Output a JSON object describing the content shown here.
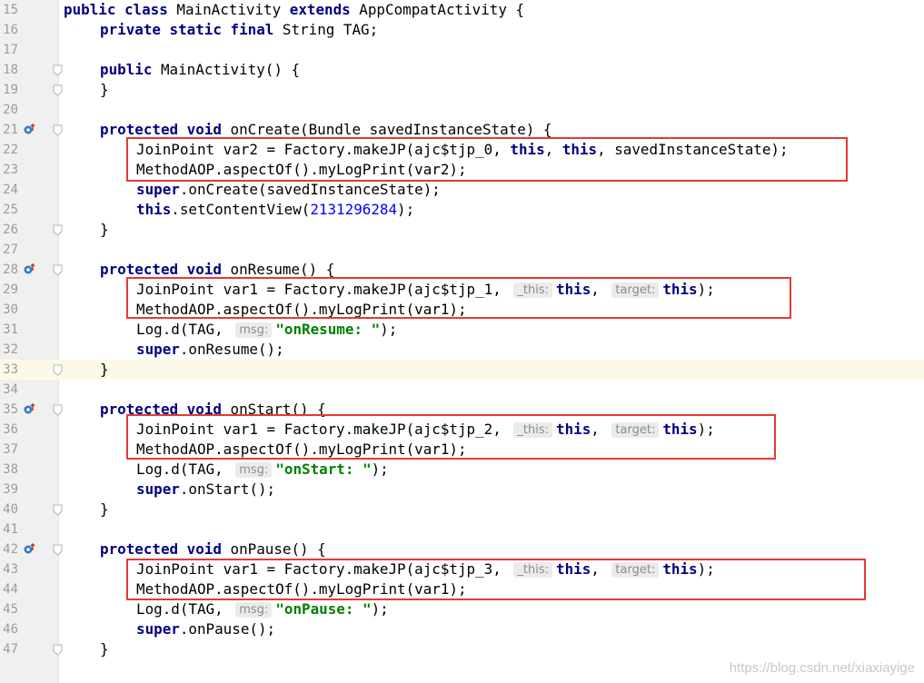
{
  "editor": {
    "lines": [
      {
        "num": "15",
        "parts": [
          {
            "t": "public class ",
            "c": "kw"
          },
          {
            "t": "MainActivity "
          },
          {
            "t": "extends ",
            "c": "kw"
          },
          {
            "t": "AppCompatActivity {"
          }
        ]
      },
      {
        "num": "16",
        "indent": 1,
        "parts": [
          {
            "t": "private static final ",
            "c": "kw"
          },
          {
            "t": "String TAG;"
          }
        ]
      },
      {
        "num": "17",
        "parts": []
      },
      {
        "num": "18",
        "indent": 1,
        "fold": true,
        "parts": [
          {
            "t": "public ",
            "c": "kw"
          },
          {
            "t": "MainActivity() {"
          }
        ]
      },
      {
        "num": "19",
        "indent": 1,
        "fold": true,
        "parts": [
          {
            "t": "}"
          }
        ]
      },
      {
        "num": "20",
        "parts": []
      },
      {
        "num": "21",
        "indent": 1,
        "fold": true,
        "override": true,
        "parts": [
          {
            "t": "protected void ",
            "c": "kw"
          },
          {
            "t": "onCreate(Bundle savedInstanceState) {"
          }
        ]
      },
      {
        "num": "22",
        "indent": 2,
        "parts": [
          {
            "t": "JoinPoint var2 = Factory.makeJP(ajc$tjp_0, "
          },
          {
            "t": "this",
            "c": "kw"
          },
          {
            "t": ", "
          },
          {
            "t": "this",
            "c": "kw"
          },
          {
            "t": ", savedInstanceState);"
          }
        ]
      },
      {
        "num": "23",
        "indent": 2,
        "parts": [
          {
            "t": "MethodAOP.aspectOf().myLogPrint(var2);"
          }
        ]
      },
      {
        "num": "24",
        "indent": 2,
        "parts": [
          {
            "t": "super",
            "c": "kw"
          },
          {
            "t": ".onCreate(savedInstanceState);"
          }
        ]
      },
      {
        "num": "25",
        "indent": 2,
        "parts": [
          {
            "t": "this",
            "c": "kw"
          },
          {
            "t": ".setContentView("
          },
          {
            "t": "2131296284",
            "c": "num"
          },
          {
            "t": ");"
          }
        ]
      },
      {
        "num": "26",
        "indent": 1,
        "fold": true,
        "parts": [
          {
            "t": "}"
          }
        ]
      },
      {
        "num": "27",
        "parts": []
      },
      {
        "num": "28",
        "indent": 1,
        "fold": true,
        "override": true,
        "parts": [
          {
            "t": "protected void ",
            "c": "kw"
          },
          {
            "t": "onResume() {"
          }
        ]
      },
      {
        "num": "29",
        "indent": 2,
        "parts": [
          {
            "t": "JoinPoint var1 = Factory.makeJP(ajc$tjp_1, "
          },
          {
            "t": "_this:",
            "c": "hint"
          },
          {
            "t": "this",
            "c": "kw"
          },
          {
            "t": ", "
          },
          {
            "t": "target:",
            "c": "hint"
          },
          {
            "t": "this",
            "c": "kw"
          },
          {
            "t": ");"
          }
        ]
      },
      {
        "num": "30",
        "indent": 2,
        "parts": [
          {
            "t": "MethodAOP.aspectOf().myLogPrint(var1);"
          }
        ]
      },
      {
        "num": "31",
        "indent": 2,
        "parts": [
          {
            "t": "Log.d(TAG, "
          },
          {
            "t": "msg:",
            "c": "hint"
          },
          {
            "t": "\"onResume: \"",
            "c": "str"
          },
          {
            "t": ");"
          }
        ]
      },
      {
        "num": "32",
        "indent": 2,
        "parts": [
          {
            "t": "super",
            "c": "kw"
          },
          {
            "t": ".onResume();"
          }
        ]
      },
      {
        "num": "33",
        "indent": 1,
        "fold": true,
        "current": true,
        "parts": [
          {
            "t": "}"
          }
        ]
      },
      {
        "num": "34",
        "parts": []
      },
      {
        "num": "35",
        "indent": 1,
        "fold": true,
        "override": true,
        "parts": [
          {
            "t": "protected void ",
            "c": "kw"
          },
          {
            "t": "onStart() {"
          }
        ]
      },
      {
        "num": "36",
        "indent": 2,
        "parts": [
          {
            "t": "JoinPoint var1 = Factory.makeJP(ajc$tjp_2, "
          },
          {
            "t": "_this:",
            "c": "hint"
          },
          {
            "t": "this",
            "c": "kw"
          },
          {
            "t": ", "
          },
          {
            "t": "target:",
            "c": "hint"
          },
          {
            "t": "this",
            "c": "kw"
          },
          {
            "t": ");"
          }
        ]
      },
      {
        "num": "37",
        "indent": 2,
        "parts": [
          {
            "t": "MethodAOP.aspectOf().myLogPrint(var1);"
          }
        ]
      },
      {
        "num": "38",
        "indent": 2,
        "parts": [
          {
            "t": "Log.d(TAG, "
          },
          {
            "t": "msg:",
            "c": "hint"
          },
          {
            "t": "\"onStart: \"",
            "c": "str"
          },
          {
            "t": ");"
          }
        ]
      },
      {
        "num": "39",
        "indent": 2,
        "parts": [
          {
            "t": "super",
            "c": "kw"
          },
          {
            "t": ".onStart();"
          }
        ]
      },
      {
        "num": "40",
        "indent": 1,
        "fold": true,
        "parts": [
          {
            "t": "}"
          }
        ]
      },
      {
        "num": "41",
        "parts": []
      },
      {
        "num": "42",
        "indent": 1,
        "fold": true,
        "override": true,
        "parts": [
          {
            "t": "protected void ",
            "c": "kw"
          },
          {
            "t": "onPause() {"
          }
        ]
      },
      {
        "num": "43",
        "indent": 2,
        "parts": [
          {
            "t": "JoinPoint var1 = Factory.makeJP(ajc$tjp_3, "
          },
          {
            "t": "_this:",
            "c": "hint"
          },
          {
            "t": "this",
            "c": "kw"
          },
          {
            "t": ", "
          },
          {
            "t": "target:",
            "c": "hint"
          },
          {
            "t": "this",
            "c": "kw"
          },
          {
            "t": ");"
          }
        ]
      },
      {
        "num": "44",
        "indent": 2,
        "parts": [
          {
            "t": "MethodAOP.aspectOf().myLogPrint(var1);"
          }
        ]
      },
      {
        "num": "45",
        "indent": 2,
        "parts": [
          {
            "t": "Log.d(TAG, "
          },
          {
            "t": "msg:",
            "c": "hint"
          },
          {
            "t": "\"onPause: \"",
            "c": "str"
          },
          {
            "t": ");"
          }
        ]
      },
      {
        "num": "46",
        "indent": 2,
        "parts": [
          {
            "t": "super",
            "c": "kw"
          },
          {
            "t": ".onPause();"
          }
        ]
      },
      {
        "num": "47",
        "indent": 1,
        "fold": true,
        "parts": [
          {
            "t": "}"
          }
        ]
      }
    ],
    "highlight_color": "#e53935"
  },
  "watermark": "https://blog.csdn.net/xiaxiayige"
}
